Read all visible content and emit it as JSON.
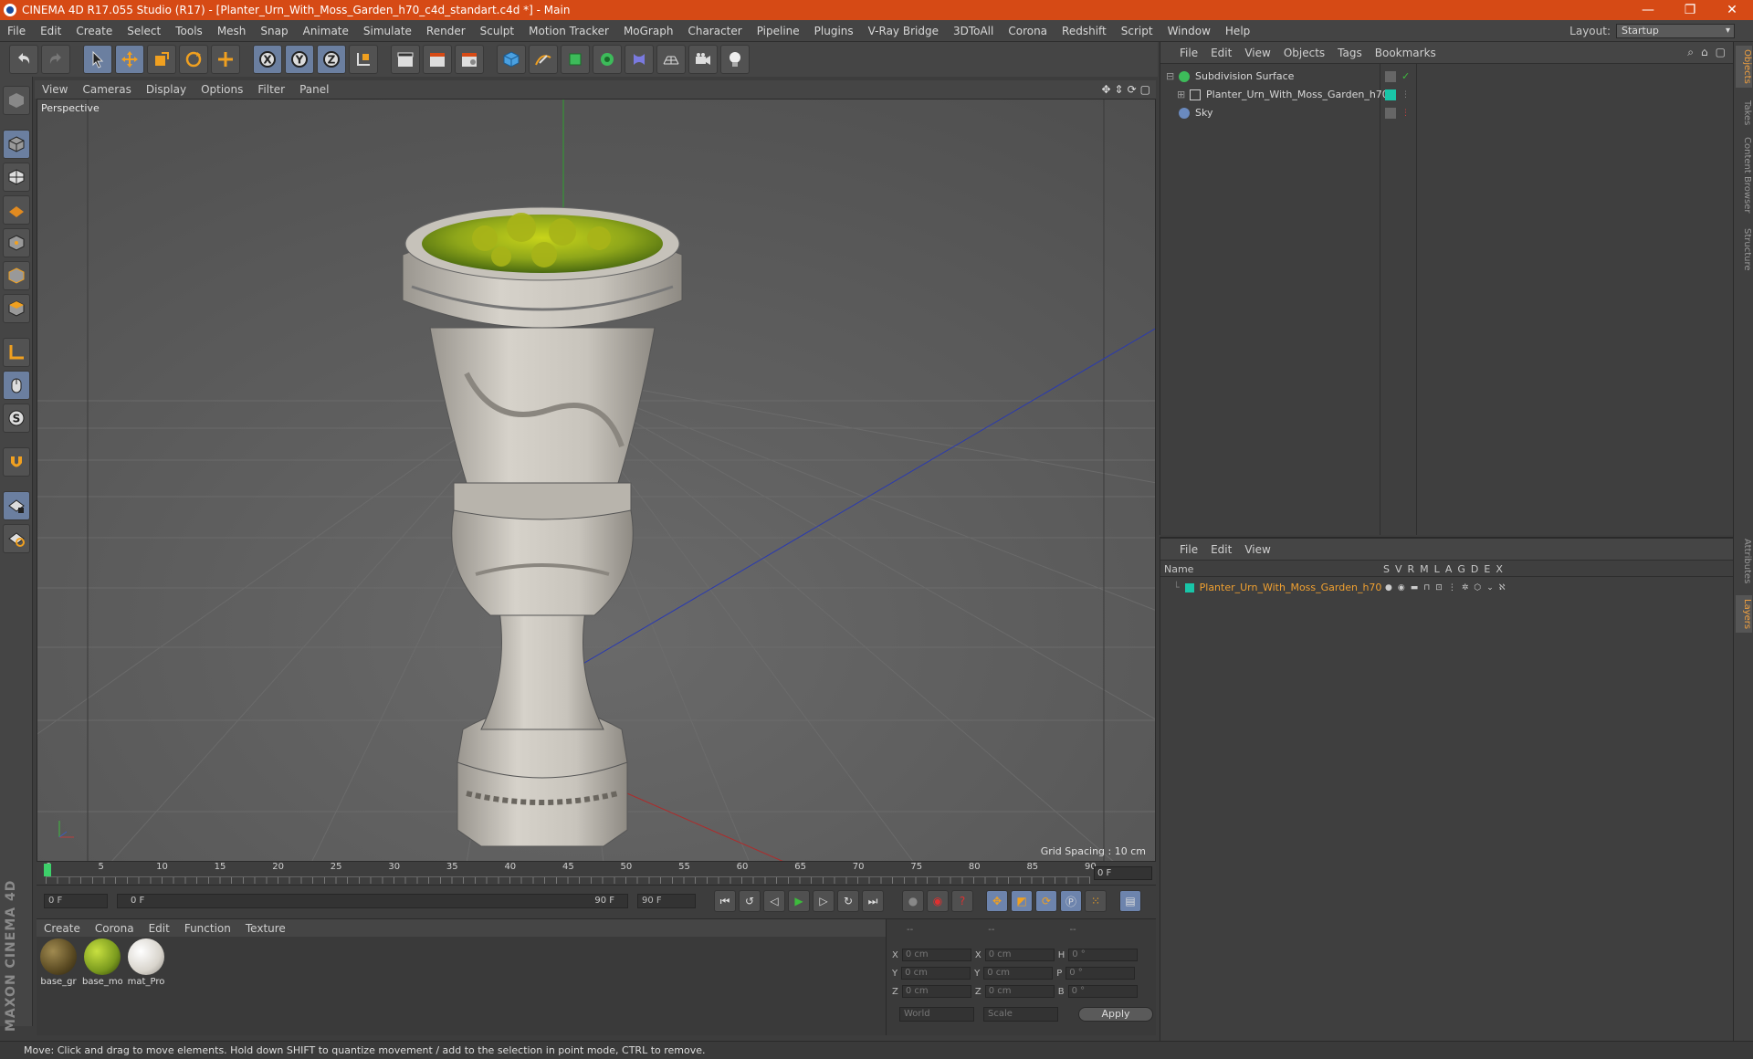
{
  "window": {
    "title": "CINEMA 4D R17.055 Studio (R17) - [Planter_Urn_With_Moss_Garden_h70_c4d_standart.c4d *] - Main",
    "minimize": "—",
    "restore": "❐",
    "close": "✕"
  },
  "menubar": {
    "items": [
      "File",
      "Edit",
      "Create",
      "Select",
      "Tools",
      "Mesh",
      "Snap",
      "Animate",
      "Simulate",
      "Render",
      "Sculpt",
      "Motion Tracker",
      "MoGraph",
      "Character",
      "Pipeline",
      "Plugins",
      "V-Ray Bridge",
      "3DToAll",
      "Corona",
      "Redshift",
      "Script",
      "Window",
      "Help"
    ],
    "layout_label": "Layout:",
    "layout_value": "Startup"
  },
  "viewport": {
    "menu": [
      "View",
      "Cameras",
      "Display",
      "Options",
      "Filter",
      "Panel"
    ],
    "camera_label": "Perspective",
    "grid_spacing": "Grid Spacing : 10 cm"
  },
  "timeline": {
    "ticks": [
      "0",
      "5",
      "10",
      "15",
      "20",
      "25",
      "30",
      "35",
      "40",
      "45",
      "50",
      "55",
      "60",
      "65",
      "70",
      "75",
      "80",
      "85",
      "90"
    ],
    "current_frame": "0 F",
    "start_field": "0 F",
    "range_start": "0 F",
    "range_end": "90 F",
    "end_field": "90 F"
  },
  "materials": {
    "menu": [
      "Create",
      "Corona",
      "Edit",
      "Function",
      "Texture"
    ],
    "items": [
      {
        "name": "base_gr",
        "color": "#5a4a22"
      },
      {
        "name": "base_mo",
        "color": "#7a9a1e"
      },
      {
        "name": "mat_Pro",
        "color": "#d8d4cc"
      }
    ]
  },
  "coords": {
    "headers": [
      "--",
      "--",
      "--"
    ],
    "rows": [
      {
        "a": "X",
        "av": "0 cm",
        "b": "X",
        "bv": "0 cm",
        "c": "H",
        "cv": "0 °"
      },
      {
        "a": "Y",
        "av": "0 cm",
        "b": "Y",
        "bv": "0 cm",
        "c": "P",
        "cv": "0 °"
      },
      {
        "a": "Z",
        "av": "0 cm",
        "b": "Z",
        "bv": "0 cm",
        "c": "B",
        "cv": "0 °"
      }
    ],
    "world": "World",
    "scale": "Scale",
    "apply": "Apply"
  },
  "objects": {
    "menu": [
      "File",
      "Edit",
      "View",
      "Objects",
      "Tags",
      "Bookmarks"
    ],
    "items": [
      {
        "name": "Subdivision Surface"
      },
      {
        "name": "Planter_Urn_With_Moss_Garden_h70"
      },
      {
        "name": "Sky"
      }
    ]
  },
  "layers": {
    "menu": [
      "File",
      "Edit",
      "View"
    ],
    "name_header": "Name",
    "col_headers": [
      "S",
      "V",
      "R",
      "M",
      "L",
      "A",
      "G",
      "D",
      "E",
      "X"
    ],
    "items": [
      {
        "name": "Planter_Urn_With_Moss_Garden_h70"
      }
    ]
  },
  "right_tabs": [
    "Objects",
    "Takes",
    "Content Browser",
    "Structure",
    "Attributes",
    "Layers"
  ],
  "status": "Move: Click and drag to move elements. Hold down SHIFT to quantize movement / add to the selection in point mode, CTRL to remove.",
  "branding": "MAXON CINEMA 4D",
  "colors": {
    "accent": "#d64a15",
    "selected_text": "#f0a030",
    "layer_swatch": "#19c5a8"
  }
}
